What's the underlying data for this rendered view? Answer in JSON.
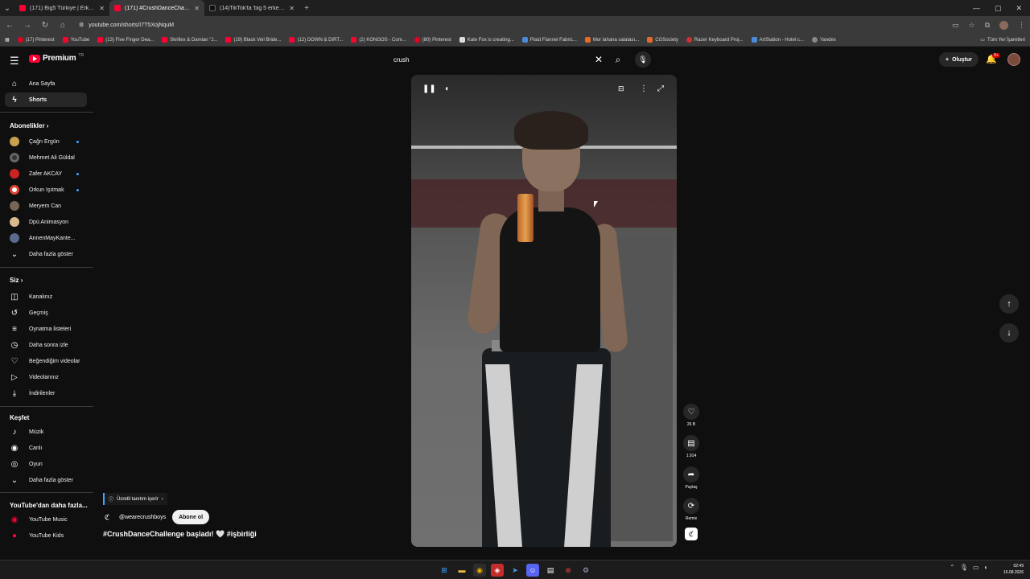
{
  "browser": {
    "tabs": [
      {
        "label": "(171) Big5 Türkiye | Erkek Hazır",
        "fav": "yt"
      },
      {
        "label": "(171) #CrushDanceChalleng",
        "fav": "yt",
        "active": true
      },
      {
        "label": "(14)TikTok'ta 'big 5 erkek probl",
        "fav": "tt"
      }
    ],
    "url": "youtube.com/shorts/I7T5XojNquM",
    "bookmarks": [
      "(17) Pinterest",
      "YouTube",
      "(13) Five Finger Dea...",
      "Skrillex & Damian \"J...",
      "(19) Black Veil Bride...",
      "(12) DOWN & DIRT...",
      "(2) KONGOS - Com...",
      "(80) Pinterest",
      "Kate Fox is creating...",
      "Plaid Flannel Fabric...",
      "Mor lahana salatası...",
      "CGSociety",
      "Razer Keyboard Proj...",
      "ArtStation - Hotel c...",
      "Yandex"
    ],
    "all_bookmarks": "Tüm Yer İşaretleri"
  },
  "header": {
    "logo_text": "Premium",
    "country": "TR",
    "search_value": "crush",
    "create_label": "Oluştur",
    "notif_badge": "9+"
  },
  "sidebar": {
    "main": [
      {
        "label": "Ana Sayfa",
        "icon": "⌂"
      },
      {
        "label": "Shorts",
        "icon": "▶"
      }
    ],
    "subs_title": "Abonelikler",
    "subs": [
      {
        "label": "Çağrı Ergün",
        "c": "ch1"
      },
      {
        "label": "Mehmet Ali Güldal",
        "c": "ch2"
      },
      {
        "label": "Zafer AKCAY",
        "c": "ch3"
      },
      {
        "label": "Orkun Işıtmak",
        "c": "ch4"
      },
      {
        "label": "Meryem Can",
        "c": "ch5"
      },
      {
        "label": "Dpü Animasyon",
        "c": "ch6"
      },
      {
        "label": "AnnenMayKante...",
        "c": "ch7"
      }
    ],
    "show_more": "Daha fazla göster",
    "you_title": "Siz",
    "you": [
      {
        "label": "Kanalınız",
        "icon": "◫"
      },
      {
        "label": "Geçmiş",
        "icon": "↺"
      },
      {
        "label": "Oynatma listeleri",
        "icon": "≡"
      },
      {
        "label": "Daha sonra izle",
        "icon": "◷"
      },
      {
        "label": "Beğendiğim videolar",
        "icon": "👍"
      },
      {
        "label": "Videolarınız",
        "icon": "▷"
      },
      {
        "label": "İndirilenler",
        "icon": "⤓"
      }
    ],
    "explore_title": "Keşfet",
    "explore": [
      {
        "label": "Müzik",
        "icon": "♪"
      },
      {
        "label": "Canlı",
        "icon": "◉"
      },
      {
        "label": "Oyun",
        "icon": "◎"
      }
    ],
    "explore_more": "Daha fazla göster",
    "yt_more_title": "YouTube'dan daha fazla...",
    "yt_more": [
      {
        "label": "YouTube Music"
      },
      {
        "label": "YouTube Kids"
      }
    ]
  },
  "short": {
    "sponsor_label": "Ücretli tanıtım içerir",
    "channel": "@wearecrushboys",
    "subscribe": "Abone ol",
    "caption": "#CrushDanceChallenge başladı! 🤍 #işbirliği",
    "likes": "26 B",
    "comments": "1.914",
    "share": "Paylaş",
    "remix": "Remix"
  },
  "clock": {
    "time": "02:49",
    "date": "16.08.2026"
  }
}
